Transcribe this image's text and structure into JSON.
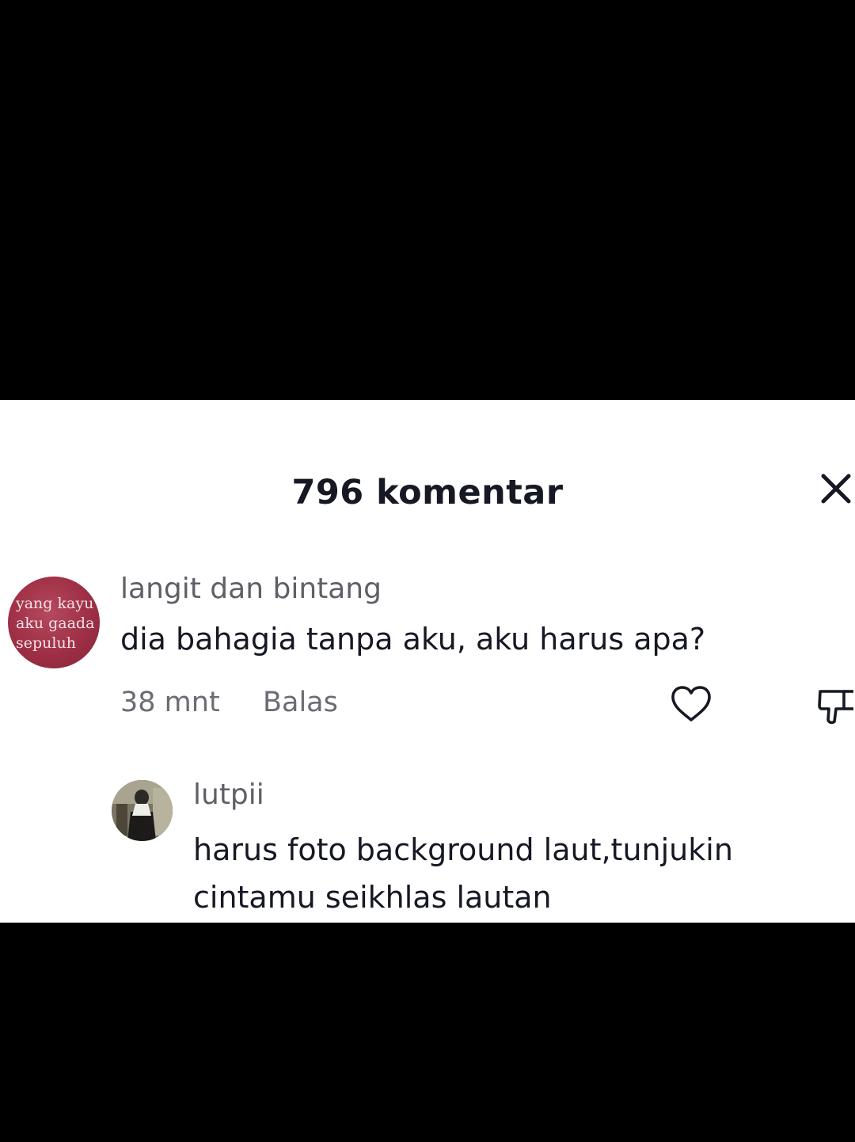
{
  "panel": {
    "title": "796 komentar",
    "close_icon": "close-icon"
  },
  "comment": {
    "avatar_text": [
      "yang kayu",
      "aku gaada",
      "sepuluh"
    ],
    "username": "langit dan bintang",
    "text": "dia bahagia tanpa aku, aku harus apa?",
    "time": "38 mnt",
    "reply_label": "Balas",
    "like_icon": "heart-icon",
    "dislike_icon": "thumbs-down-icon"
  },
  "reply": {
    "username": "lutpii",
    "text_line1": "harus foto background laut,tunjukin",
    "text_line2": "cintamu seikhlas lautan"
  },
  "colors": {
    "background": "#000000",
    "panel": "#ffffff",
    "primary_text": "#161823",
    "secondary_text": "#5f5f66",
    "avatar_red": "#9e2f45"
  }
}
